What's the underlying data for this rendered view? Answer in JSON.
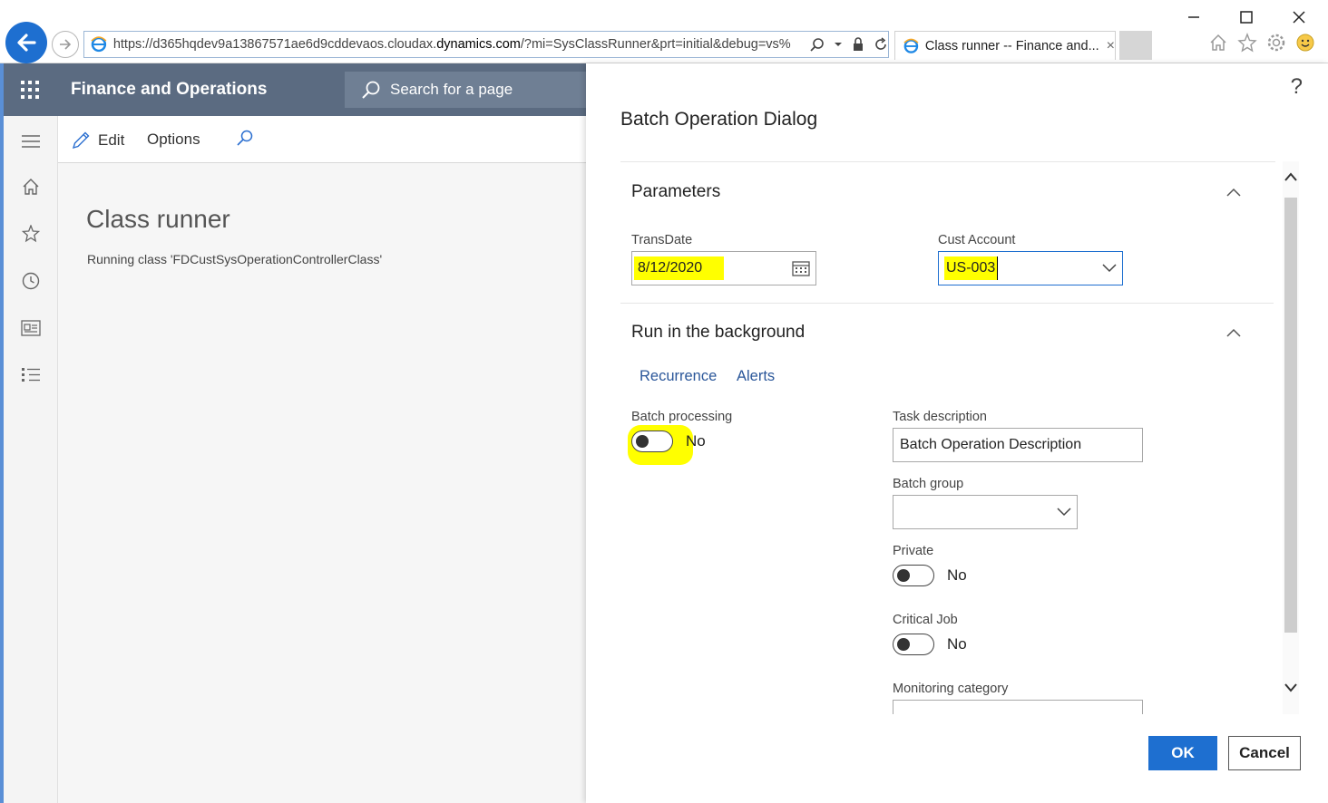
{
  "browser": {
    "url_prefix": "https://d365hqdev9a13867571ae6d9cddevaos.cloudax.",
    "url_domain": "dynamics.com",
    "url_suffix": "/?mi=SysClassRunner&prt=initial&debug=vs%",
    "tab_title": "Class runner -- Finance and...",
    "tab_close": "×"
  },
  "window": {
    "minimize": "—",
    "maximize": "☐",
    "close": "✕"
  },
  "header": {
    "app_title": "Finance and Operations",
    "search_placeholder": "Search for a page"
  },
  "actions": {
    "edit": "Edit",
    "options": "Options"
  },
  "page": {
    "title": "Class runner",
    "subtitle": "Running class 'FDCustSysOperationControllerClass'"
  },
  "dialog": {
    "help": "?",
    "title": "Batch Operation Dialog",
    "parameters": {
      "section_title": "Parameters",
      "transdate_label": "TransDate",
      "transdate_value": "8/12/2020",
      "custaccount_label": "Cust Account",
      "custaccount_value": "US-003"
    },
    "background": {
      "section_title": "Run in the background",
      "tab_recurrence": "Recurrence",
      "tab_alerts": "Alerts",
      "batch_processing_label": "Batch processing",
      "batch_processing_value": "No",
      "task_description_label": "Task description",
      "task_description_value": "Batch Operation Description",
      "batch_group_label": "Batch group",
      "batch_group_value": "",
      "private_label": "Private",
      "private_value": "No",
      "critical_job_label": "Critical Job",
      "critical_job_value": "No",
      "monitoring_category_label": "Monitoring category"
    },
    "ok_label": "OK",
    "cancel_label": "Cancel"
  },
  "colors": {
    "accent": "#1e6fd0",
    "header_bg": "#5b6b81",
    "highlight": "#ffff00",
    "link": "#2b579a"
  }
}
